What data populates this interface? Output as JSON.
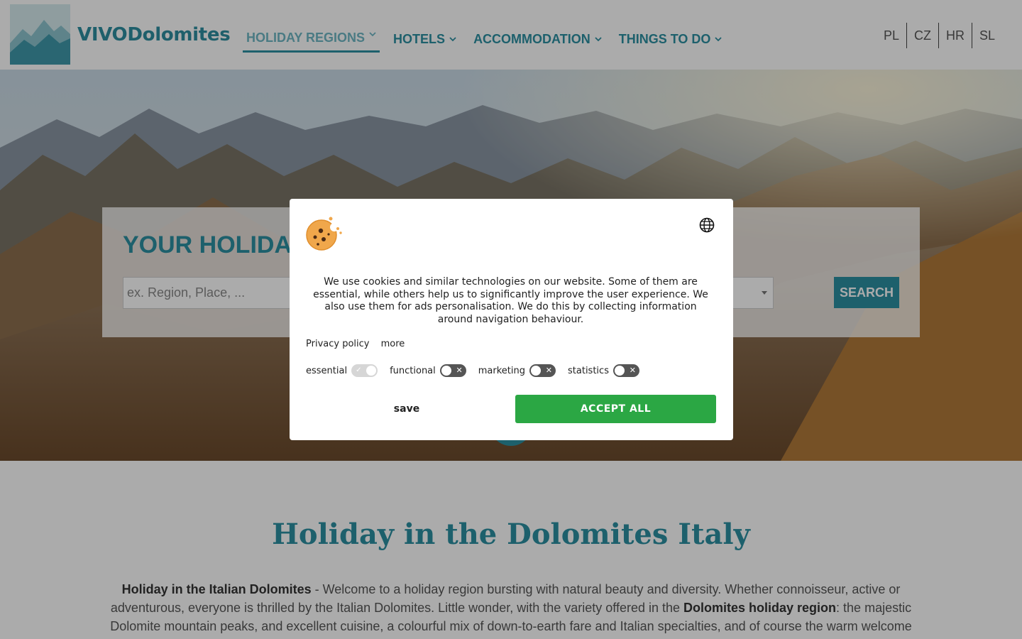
{
  "header": {
    "logo_text": "VIVODolomites",
    "nav": [
      {
        "label": "HOLIDAY REGIONS",
        "active": true
      },
      {
        "label": "HOTELS"
      },
      {
        "label": "ACCOMMODATION"
      },
      {
        "label": "THINGS TO DO"
      }
    ],
    "languages": [
      "PL",
      "CZ",
      "HR",
      "SL"
    ]
  },
  "search": {
    "title": "YOUR HOLIDAY.",
    "placeholder": "ex. Region, Place, ...",
    "button": "SEARCH"
  },
  "content": {
    "title": "Holiday in the Dolomites Italy",
    "para_bold1": "Holiday in the Italian Dolomites",
    "para_text1": " - Welcome to a holiday region bursting with natural beauty and diversity. Whether connoisseur, active or adventurous, everyone is thrilled by the Italian Dolomites. Little wonder, with the variety offered in the ",
    "para_bold2": "Dolomites holiday region",
    "para_text2": ": the majestic Dolomite mountain peaks, and excellent cuisine, a colourful mix of down-to-earth fare and Italian specialties, and of course the warm welcome that"
  },
  "cookie_modal": {
    "text": "We use cookies and similar technologies on our website. Some of them are essential, while others help us to significantly improve the user experience. We also use them for ads personalisation. We do this by collecting information around navigation behaviour.",
    "privacy_link": "Privacy policy",
    "more_link": "more",
    "toggles": [
      {
        "label": "essential",
        "enabled": true,
        "locked": true
      },
      {
        "label": "functional",
        "enabled": false
      },
      {
        "label": "marketing",
        "enabled": false
      },
      {
        "label": "statistics",
        "enabled": false
      }
    ],
    "save_label": "save",
    "accept_label": "ACCEPT ALL"
  },
  "colors": {
    "brand": "#2c8fa2",
    "accept": "#2ba744"
  },
  "icons": [
    "logo-mountain-icon",
    "chevron-down-icon",
    "cookie-icon",
    "globe-icon",
    "close-icon",
    "check-icon"
  ]
}
